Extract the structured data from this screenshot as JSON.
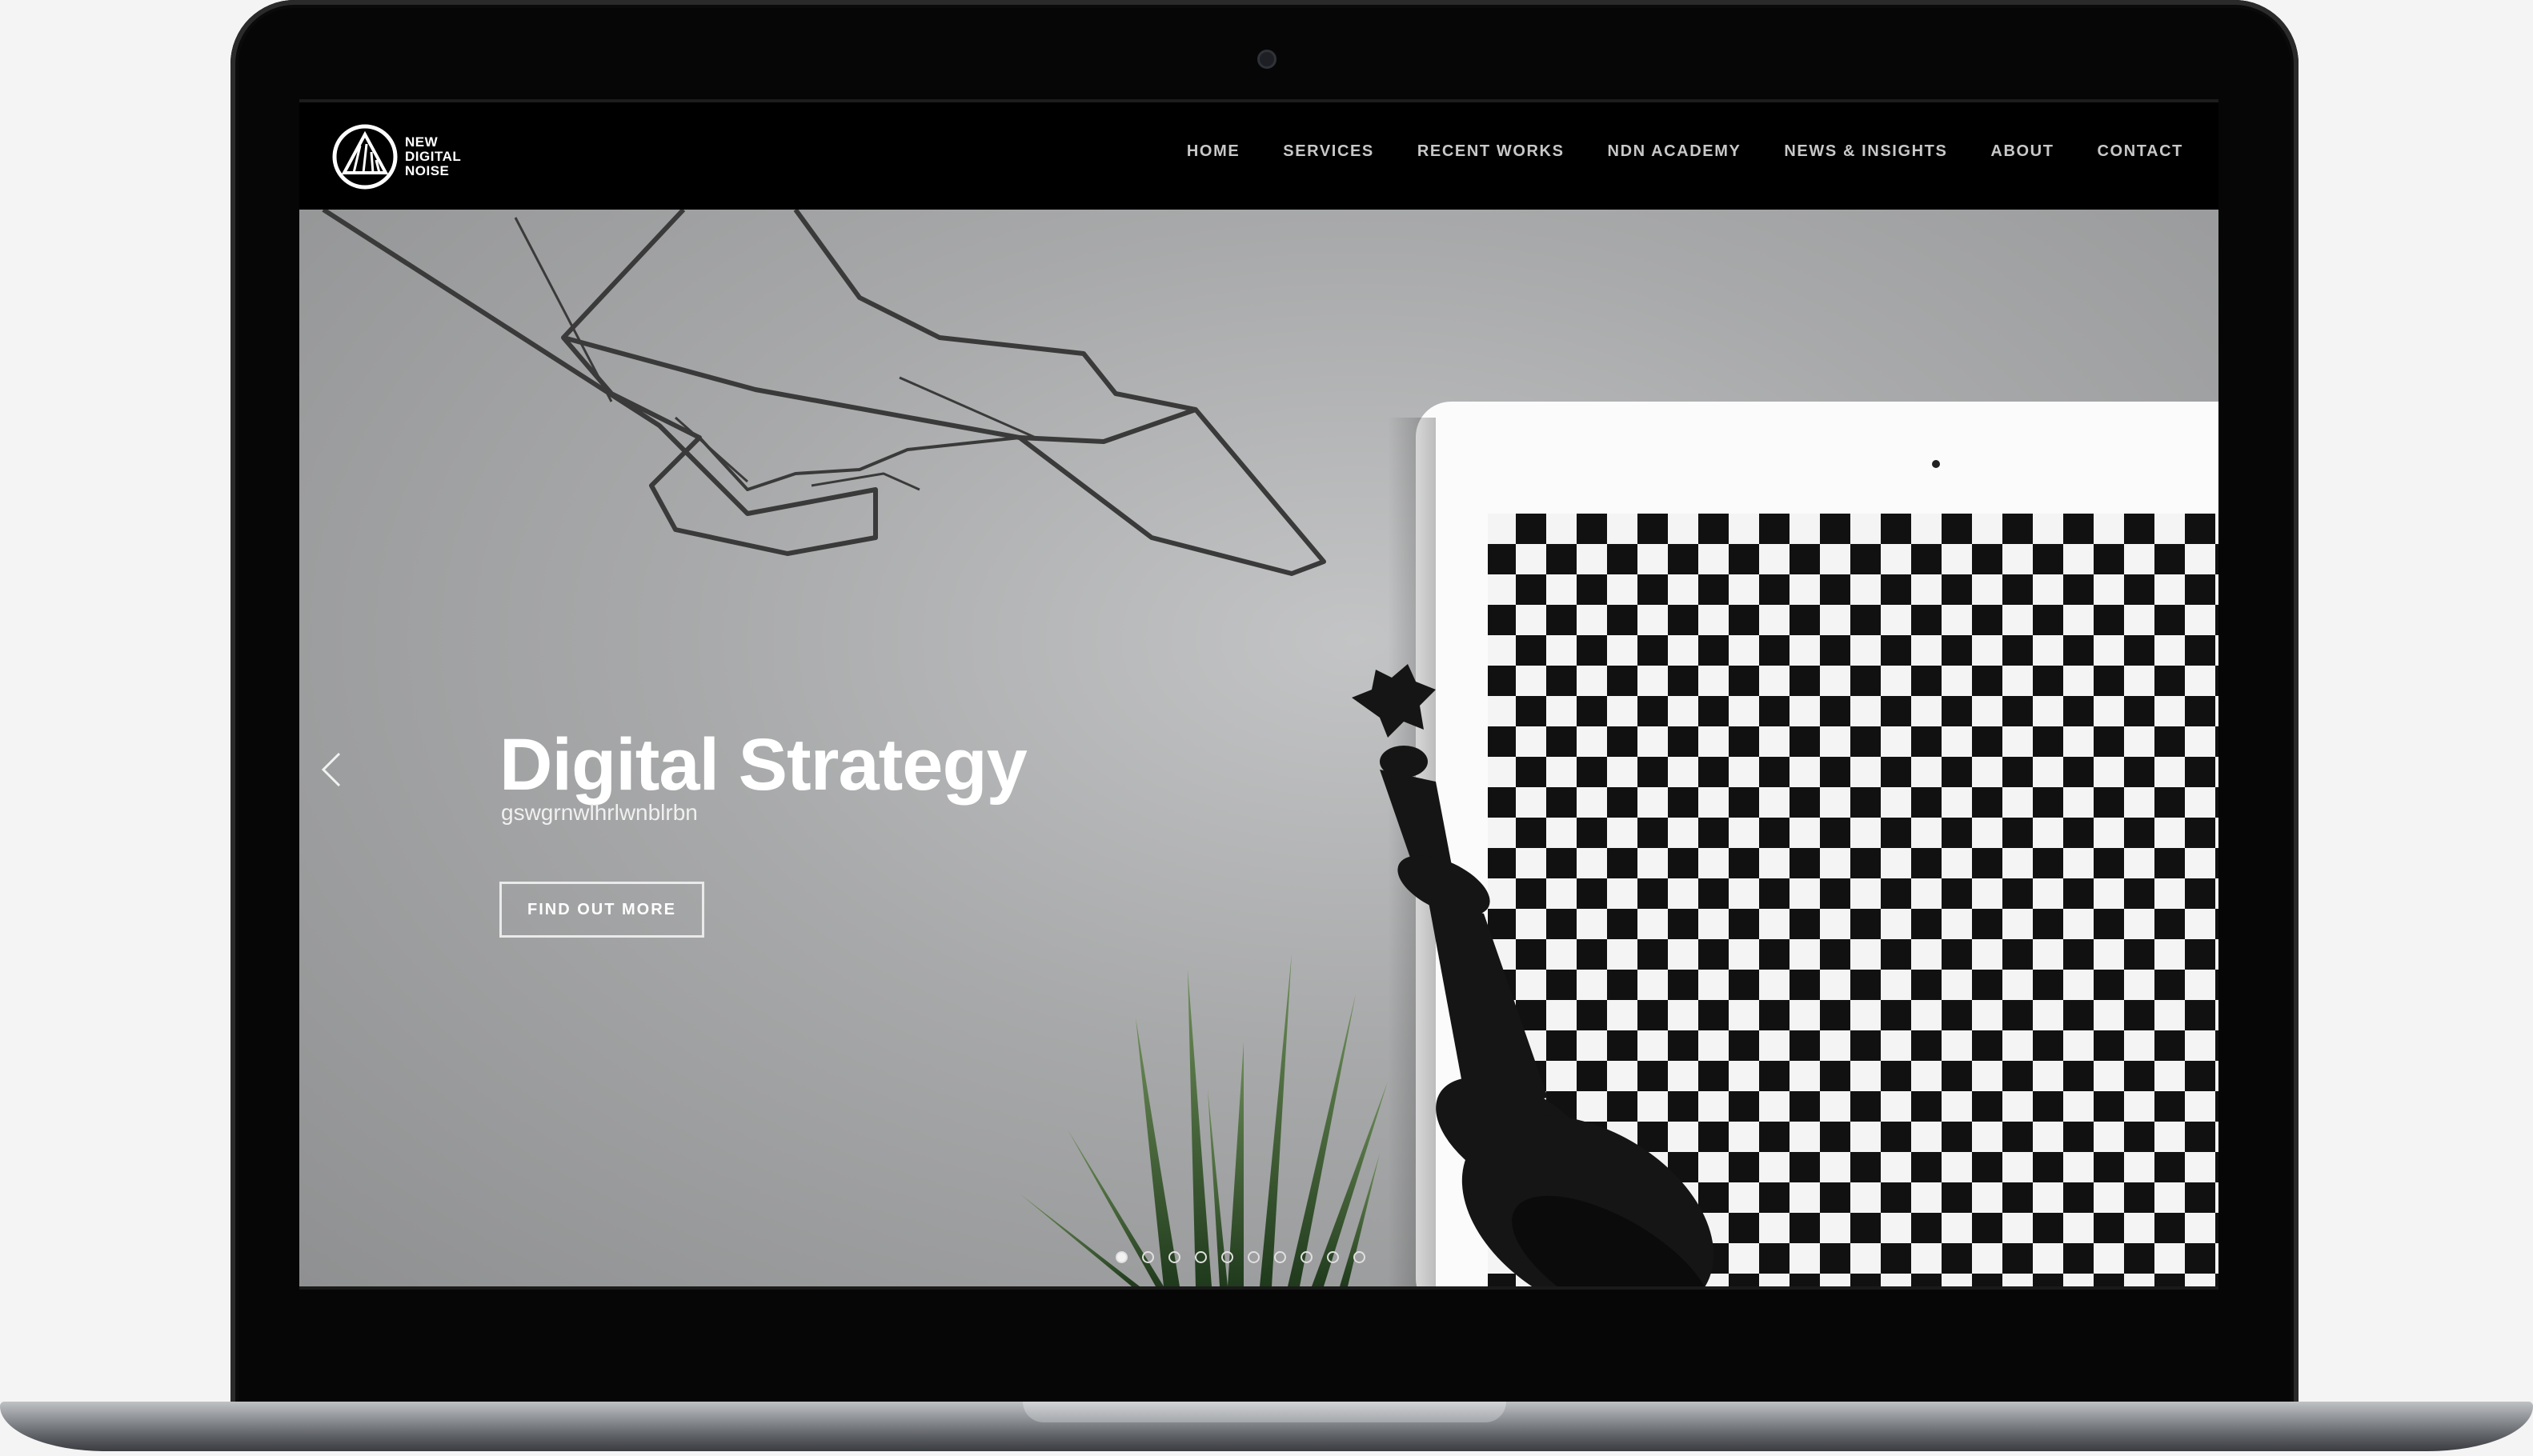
{
  "brand": {
    "logo_text": "NEW\nDIGITAL\nNOISE"
  },
  "nav": {
    "items": [
      {
        "label": "HOME"
      },
      {
        "label": "SERVICES"
      },
      {
        "label": "RECENT WORKS"
      },
      {
        "label": "NDN ACADEMY"
      },
      {
        "label": "NEWS & INSIGHTS"
      },
      {
        "label": "ABOUT"
      },
      {
        "label": "CONTACT"
      }
    ]
  },
  "hero": {
    "title": "Digital Strategy",
    "subtitle": "gswgrnwlhrlwnblrbn",
    "cta_label": "FIND OUT MORE",
    "slide_count": 10,
    "active_slide": 1
  },
  "colors": {
    "nav_text": "#c8c8c8",
    "hero_text": "#ffffff",
    "screen_bg": "#000000"
  },
  "icons": {
    "prev": "chevron-left-icon",
    "logo": "triangle-logo-icon"
  }
}
